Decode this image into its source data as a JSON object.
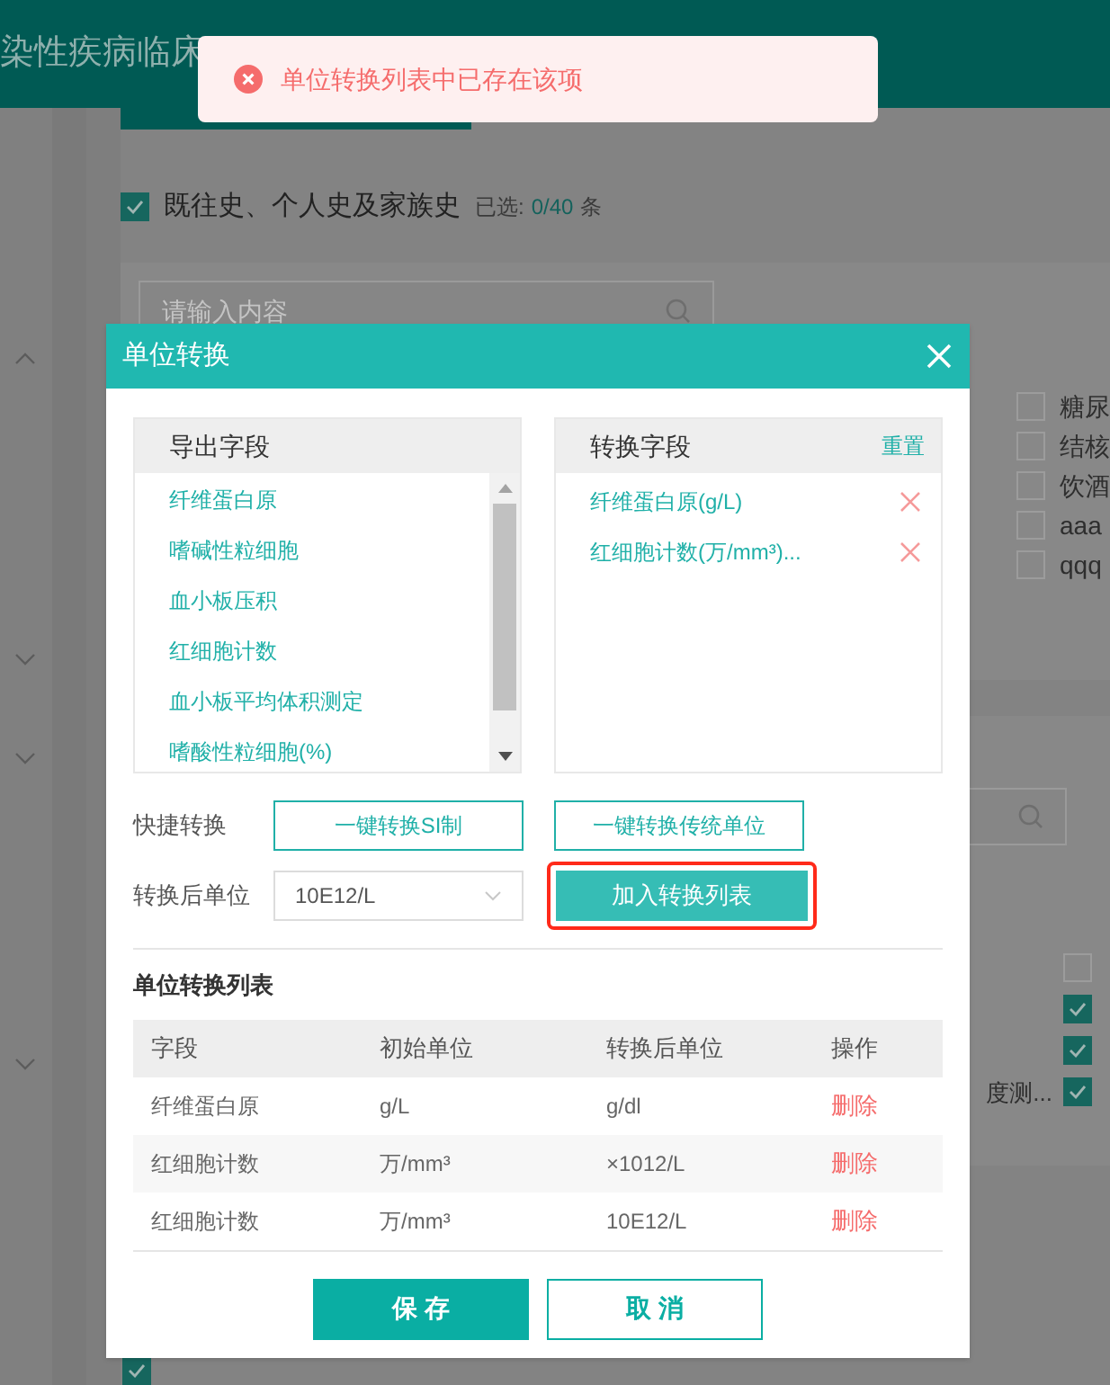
{
  "background": {
    "header_title": "染性疾病临床",
    "section": {
      "title": "既往史、个人史及家族史",
      "selected_label": "已选:",
      "selected_count": "0/40",
      "unit": "条",
      "checked": true
    },
    "search": {
      "placeholder": "请输入内容"
    },
    "options": [
      {
        "label": "糖尿",
        "checked": false
      },
      {
        "label": "结核",
        "checked": false
      },
      {
        "label": "饮酒",
        "checked": false
      },
      {
        "label": "aaa",
        "checked": false
      },
      {
        "label": "qqq",
        "checked": false
      }
    ],
    "selected_fields": [
      {
        "checked": false
      },
      {
        "checked": true
      },
      {
        "checked": true
      },
      {
        "label": "度测...",
        "checked": true
      }
    ],
    "bottom_checked": true
  },
  "toast": {
    "kind": "error",
    "message": "单位转换列表中已存在该项"
  },
  "dialog": {
    "title": "单位转换",
    "export_fields": {
      "title": "导出字段",
      "items": [
        "纤维蛋白原",
        "嗜碱性粒细胞",
        "血小板压积",
        "红细胞计数",
        "血小板平均体积测定",
        "嗜酸性粒细胞(%)"
      ]
    },
    "convert_fields": {
      "title": "转换字段",
      "reset": "重置",
      "items": [
        "纤维蛋白原(g/L)",
        "红细胞计数(万/mm³)..."
      ]
    },
    "quick": {
      "label": "快捷转换",
      "buttons": [
        "一键转换SI制",
        "一键转换传统单位"
      ]
    },
    "unit": {
      "label": "转换后单位",
      "value": "10E12/L",
      "button": "加入转换列表",
      "highlighted": true
    },
    "list": {
      "title": "单位转换列表",
      "columns": [
        "字段",
        "初始单位",
        "转换后单位",
        "操作"
      ],
      "rows": [
        {
          "field": "纤维蛋白原",
          "from": "g/L",
          "to": "g/dl",
          "action": "删除"
        },
        {
          "field": "红细胞计数",
          "from": "万/mm³",
          "to": "×1012/L",
          "action": "删除"
        },
        {
          "field": "红细胞计数",
          "from": "万/mm³",
          "to": "10E12/L",
          "action": "删除"
        }
      ]
    },
    "buttons": [
      {
        "label": "保 存",
        "kind": "primary"
      },
      {
        "label": "取 消",
        "kind": "secondary"
      }
    ]
  }
}
